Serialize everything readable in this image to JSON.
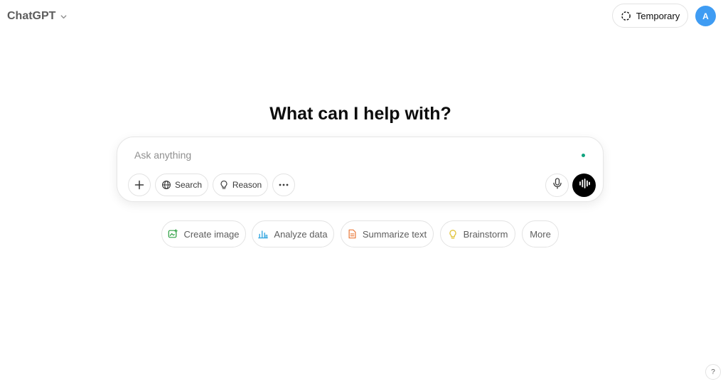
{
  "header": {
    "model_name": "ChatGPT",
    "temporary_label": "Temporary",
    "avatar_initial": "A"
  },
  "main": {
    "headline": "What can I help with?"
  },
  "composer": {
    "placeholder": "Ask anything",
    "value": "",
    "tools": {
      "search_label": "Search",
      "reason_label": "Reason"
    }
  },
  "suggestions": [
    {
      "label": "Create image",
      "icon": "create-image-icon",
      "color": "#2ea043"
    },
    {
      "label": "Analyze data",
      "icon": "bar-chart-icon",
      "color": "#35a7e0"
    },
    {
      "label": "Summarize text",
      "icon": "document-icon",
      "color": "#ea7a3b"
    },
    {
      "label": "Brainstorm",
      "icon": "lightbulb-icon",
      "color": "#e2c541"
    },
    {
      "label": "More",
      "icon": "",
      "color": ""
    }
  ],
  "help": {
    "label": "?"
  },
  "colors": {
    "avatar": "#3f9cf3",
    "status_dot": "#10a37f",
    "voice_button": "#000000"
  }
}
